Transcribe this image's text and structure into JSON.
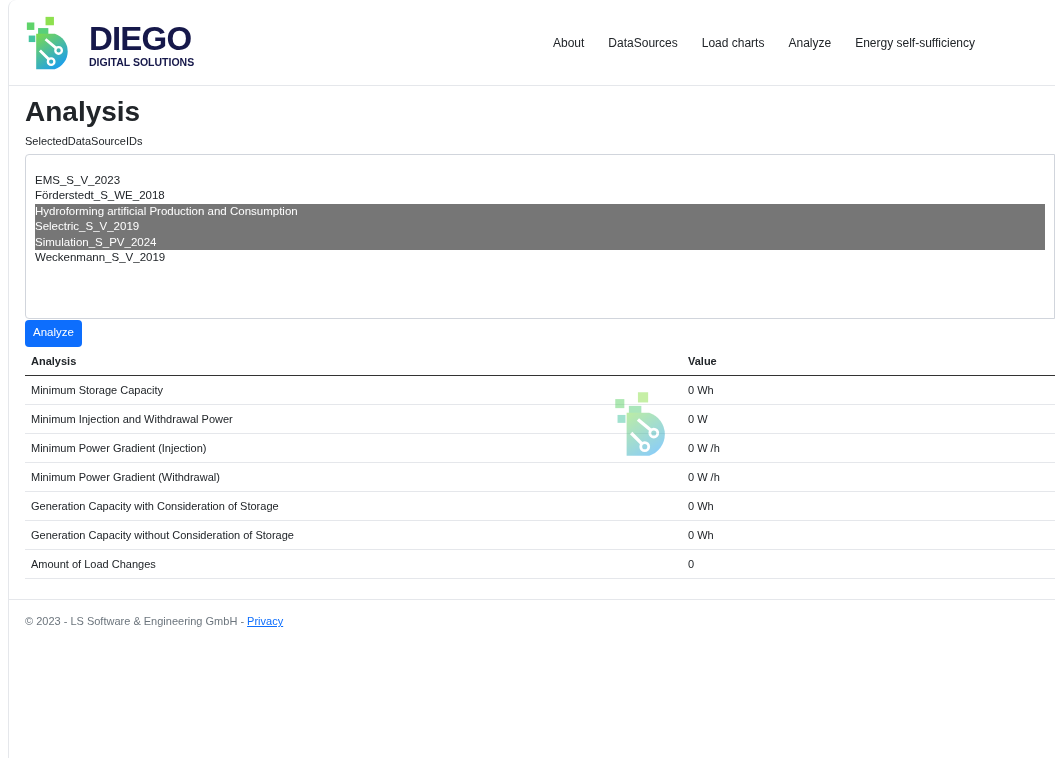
{
  "header": {
    "brand": "DIEGO",
    "tagline": "DIGITAL SOLUTIONS",
    "nav": [
      "About",
      "DataSources",
      "Load charts",
      "Analyze",
      "Energy self-sufficiency"
    ]
  },
  "page_title": "Analysis",
  "field_label": "SelectedDataSourceIDs",
  "sources": [
    {
      "label": "EMS_S_V_2023",
      "selected": false
    },
    {
      "label": "Förderstedt_S_WE_2018",
      "selected": false
    },
    {
      "label": "Hydroforming artificial Production and Consumption",
      "selected": true
    },
    {
      "label": "Selectric_S_V_2019",
      "selected": true
    },
    {
      "label": "Simulation_S_PV_2024",
      "selected": true
    },
    {
      "label": "Weckenmann_S_V_2019",
      "selected": false
    }
  ],
  "analyze_button": "Analyze",
  "loading_overlay": true,
  "table": {
    "columns": [
      "Analysis",
      "Value"
    ],
    "rows": [
      [
        "Minimum Storage Capacity",
        "0 Wh"
      ],
      [
        "Minimum Injection and Withdrawal Power",
        "0 W"
      ],
      [
        "Minimum Power Gradient (Injection)",
        "0 W /h"
      ],
      [
        "Minimum Power Gradient (Withdrawal)",
        "0 W /h"
      ],
      [
        "Generation Capacity with Consideration of Storage",
        "0 Wh"
      ],
      [
        "Generation Capacity without Consideration of Storage",
        "0 Wh"
      ],
      [
        "Amount of Load Changes",
        "0"
      ]
    ]
  },
  "footer": {
    "text": "© 2023 - LS Software & Engineering GmbH - ",
    "link": "Privacy"
  }
}
